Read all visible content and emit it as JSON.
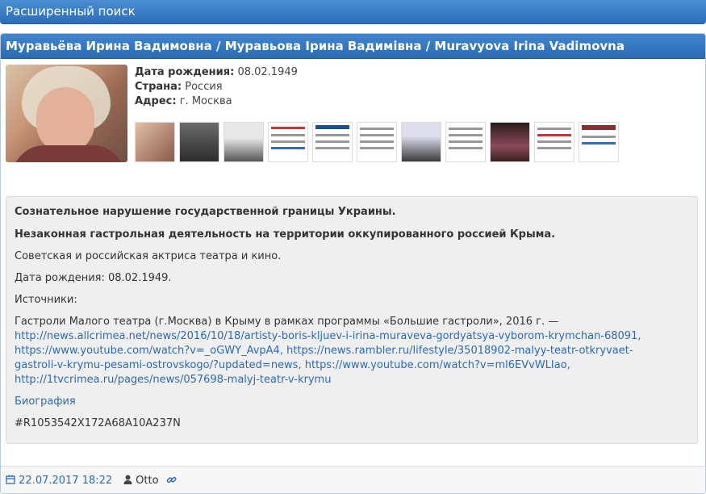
{
  "topbar": {
    "title": "Расширенный поиск"
  },
  "person": {
    "header": "Муравьёва Ирина Вадимовна / Муравьова Ірина Вадимівна / Muravyova Irina Vadimovna",
    "fields": [
      {
        "label": "Дата рождения:",
        "value": "08.02.1949"
      },
      {
        "label": "Страна:",
        "value": "Россия"
      },
      {
        "label": "Адрес:",
        "value": "г. Москва"
      }
    ],
    "thumbnails": [
      "portrait",
      "people-at-table",
      "press-conference",
      "news-page",
      "news-page",
      "news-page",
      "press-conference",
      "news-page",
      "stage-photo",
      "news-page",
      "news-page"
    ]
  },
  "description": {
    "line1": "Сознательное нарушение государственной границы Украины.",
    "line2": "Незаконная гастрольная деятельность на территории оккупированного россией Крыма.",
    "line3": "Советская и российская актриса театра и кино.",
    "line4": "Дата рождения: 08.02.1949.",
    "sources_label": "Источники:",
    "sources_text": "Гастроли Малого театра (г.Москва) в Крыму в рамках программы «Большие гастроли», 2016 г. —",
    "link1": "http://news.allcrimea.net/news/2016/10/18/artisty-boris-kljuev-i-irina-muraveva-gordyatsya-vyborom-krymchan-68091,",
    "link2": "https://www.youtube.com/watch?v=_oGWY_AvpA4,",
    "link3a": "https://news.rambler.ru/lifestyle/35018902-malyy-teatr-otkryvaet-",
    "link3b": "gastroli-v-krymu-pesami-ostrovskogo/?updated=news,",
    "link4": "https://www.youtube.com/watch?v=ml6EVvWLIao,",
    "link5": "http://1tvcrimea.ru/pages/news/057698-malyj-teatr-v-krymu",
    "bio_link": "Биография",
    "code": "#R1053542X172A68A10A237N"
  },
  "footer": {
    "date": "22.07.2017 18:22",
    "author": "Otto"
  },
  "colors": {
    "header_blue": "#2a6bb4",
    "link": "#2a6bb4"
  }
}
